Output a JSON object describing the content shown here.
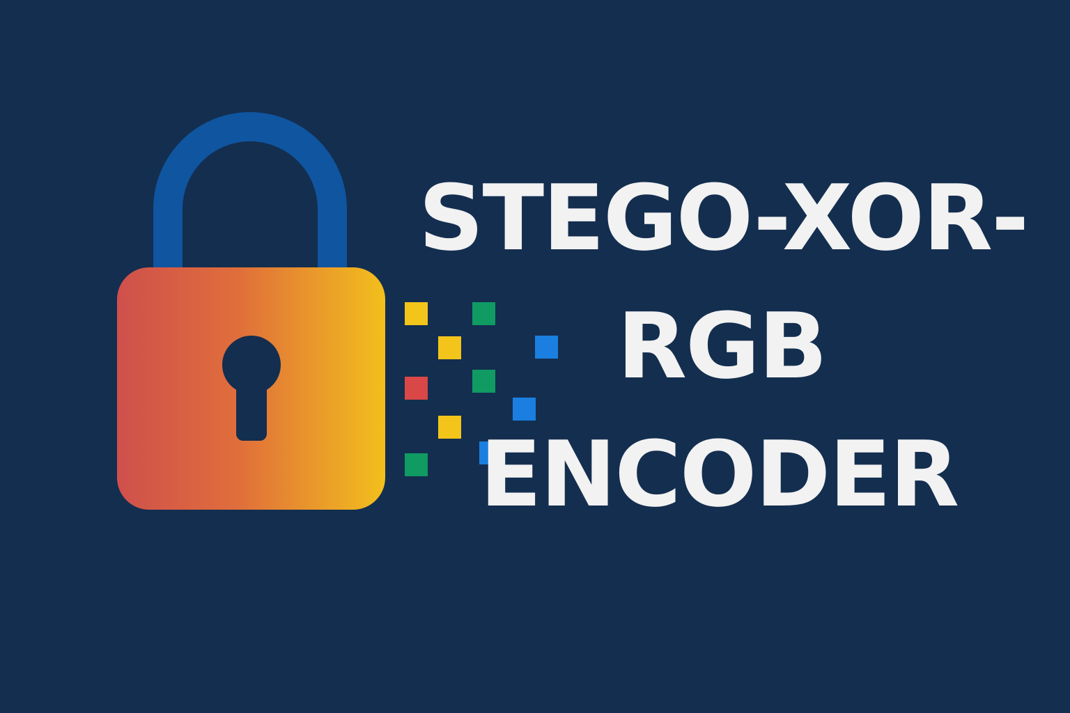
{
  "title": {
    "line1": "STEGO-XOR-",
    "line2": "RGB",
    "line3": "ENCODER"
  },
  "colors": {
    "background": "#142e4f",
    "shackle": "#0f55a0",
    "lock_body_left": "#cf504c",
    "lock_body_right": "#f2bf1c",
    "text": "#f2f2f2",
    "pixel_yellow": "#f3c51b",
    "pixel_green": "#0f9b62",
    "pixel_blue": "#1a7fe0",
    "pixel_red": "#d94747"
  },
  "icons": [
    "padlock-icon",
    "keyhole-icon",
    "pixel-squares"
  ]
}
